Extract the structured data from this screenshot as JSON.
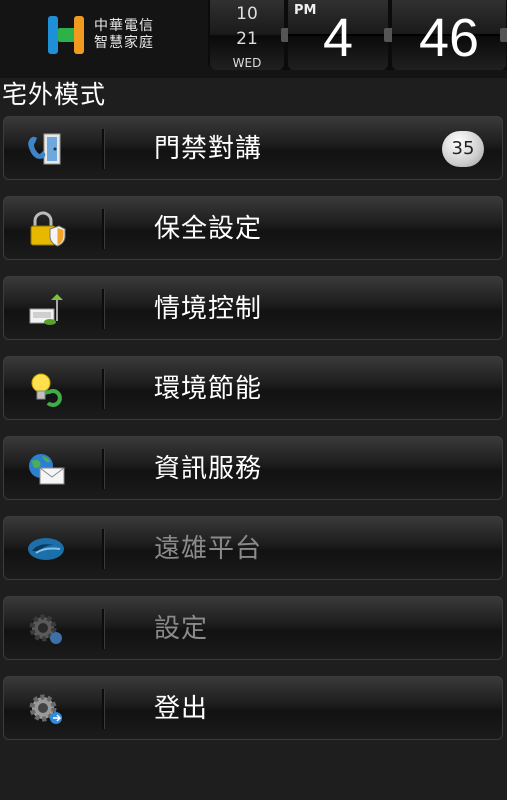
{
  "logo": {
    "line1": "中華電信",
    "line2": "智慧家庭"
  },
  "clock": {
    "month": "10",
    "day": "21",
    "weekday": "WED",
    "ampm": "PM",
    "hour": "4",
    "minute": "46"
  },
  "mode_title": "宅外模式",
  "menu": [
    {
      "label": "門禁對講",
      "icon": "door-phone-icon",
      "badge": "35",
      "enabled": true
    },
    {
      "label": "保全設定",
      "icon": "lock-shield-icon",
      "enabled": true
    },
    {
      "label": "情境控制",
      "icon": "scene-lamp-icon",
      "enabled": true
    },
    {
      "label": "環境節能",
      "icon": "eco-bulb-icon",
      "enabled": true
    },
    {
      "label": "資訊服務",
      "icon": "globe-mail-icon",
      "enabled": true
    },
    {
      "label": "遠雄平台",
      "icon": "platform-logo-icon",
      "enabled": false
    },
    {
      "label": "設定",
      "icon": "gear-icon",
      "enabled": false
    },
    {
      "label": "登出",
      "icon": "gear-logout-icon",
      "enabled": true
    }
  ],
  "colors": {
    "background": "#1e1e1e",
    "logo_green": "#2bb34a",
    "logo_blue": "#1f8fd8",
    "logo_orange": "#f29a1f",
    "disabled_text": "#8a8a8a"
  }
}
